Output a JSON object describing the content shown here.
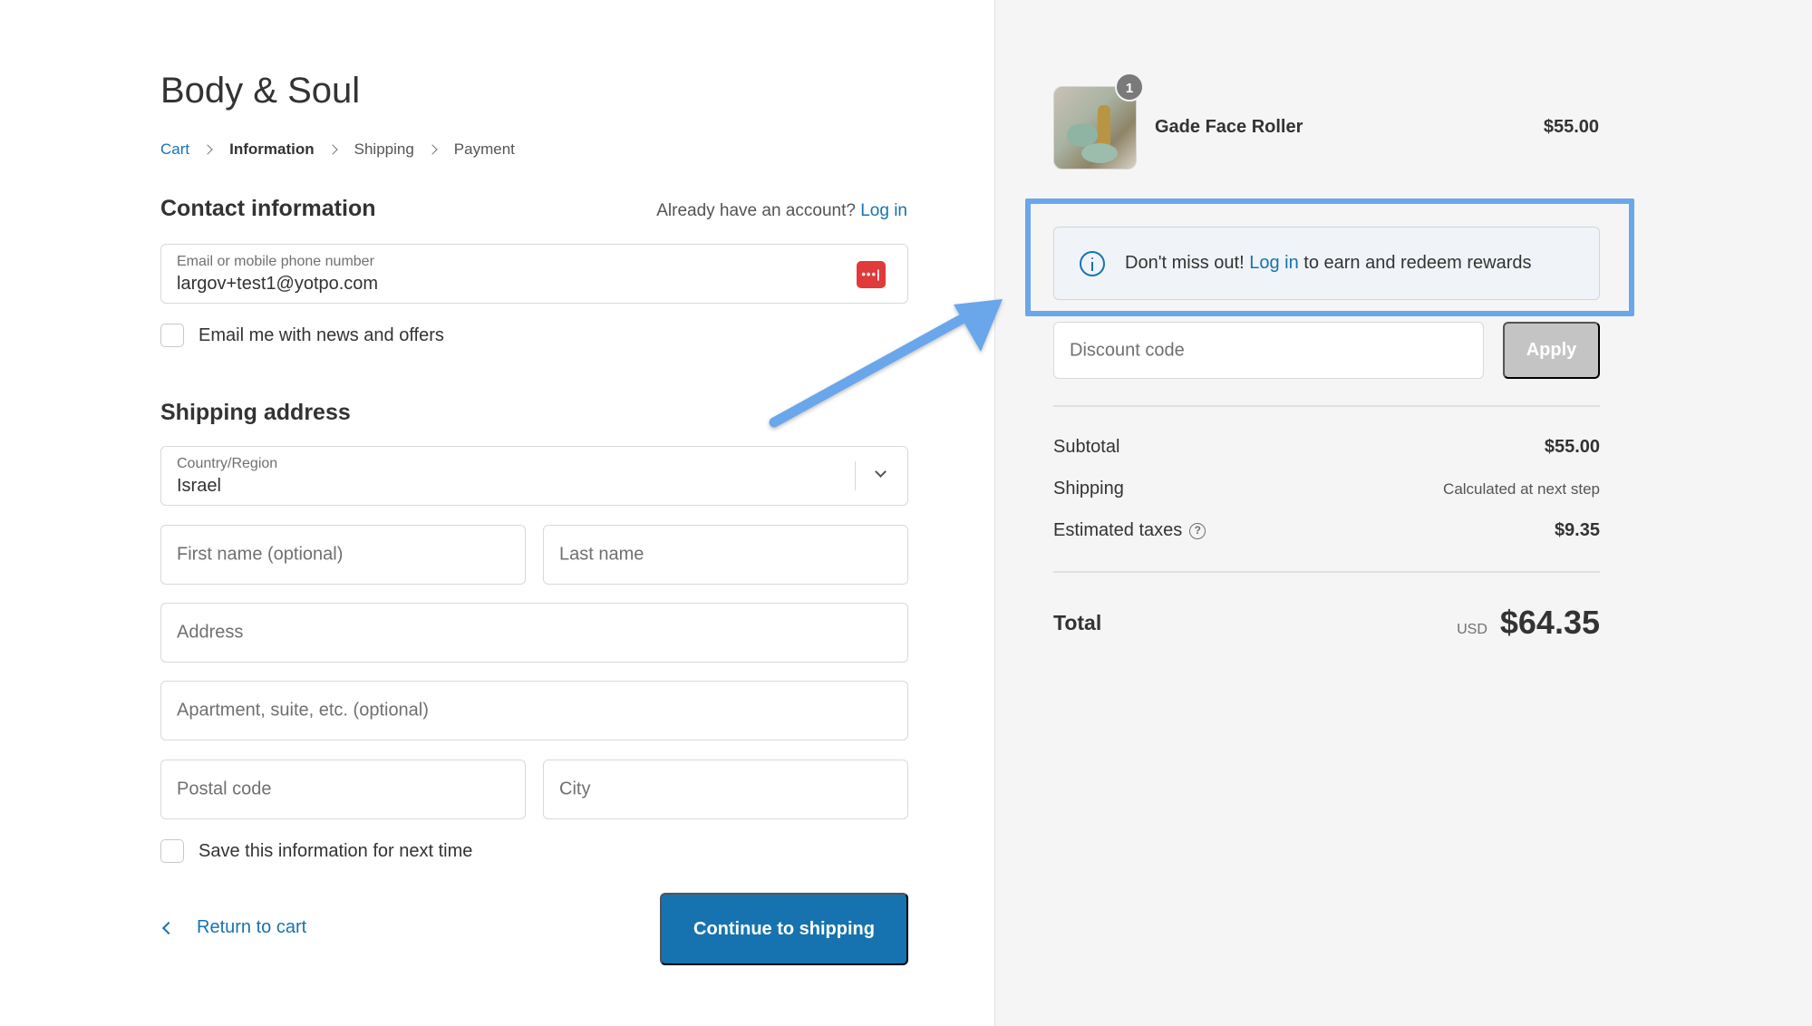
{
  "store": {
    "title": "Body & Soul"
  },
  "breadcrumb": {
    "items": [
      {
        "label": "Cart"
      },
      {
        "label": "Information"
      },
      {
        "label": "Shipping"
      },
      {
        "label": "Payment"
      }
    ]
  },
  "contact": {
    "title": "Contact information",
    "account_prompt": "Already have an account?",
    "login_label": "Log in",
    "email_label": "Email or mobile phone number",
    "email_value": "largov+test1@yotpo.com",
    "password_manager_icon": "•••|",
    "newsletter_label": "Email me with news and offers"
  },
  "shipping": {
    "title": "Shipping address",
    "country_label": "Country/Region",
    "country_value": "Israel",
    "first_name_placeholder": "First name (optional)",
    "last_name_placeholder": "Last name",
    "address_placeholder": "Address",
    "apartment_placeholder": "Apartment, suite, etc. (optional)",
    "postal_placeholder": "Postal code",
    "city_placeholder": "City",
    "save_info_label": "Save this information for next time"
  },
  "actions": {
    "return_label": "Return to cart",
    "continue_label": "Continue to shipping"
  },
  "summary": {
    "product": {
      "name": "Gade Face Roller",
      "price": "$55.00",
      "quantity": "1"
    },
    "rewards": {
      "prefix": "Don't miss out!",
      "link": "Log in",
      "suffix": "to earn and redeem rewards"
    },
    "discount_placeholder": "Discount code",
    "apply_label": "Apply",
    "subtotal_label": "Subtotal",
    "subtotal_value": "$55.00",
    "shipping_label": "Shipping",
    "shipping_value": "Calculated at next step",
    "taxes_label": "Estimated taxes",
    "taxes_help": "?",
    "taxes_value": "$9.35",
    "total_label": "Total",
    "currency": "USD",
    "total_value": "$64.35"
  },
  "colors": {
    "link": "#1773b0",
    "primary_button": "#1773b0",
    "highlight_annotation": "#6ba6ea",
    "apply_disabled": "#c4c4c4",
    "sidebar_background": "#f5f5f5"
  },
  "icons": [
    "chevron-right-icon",
    "password-manager-icon",
    "chevron-down-icon",
    "chevron-left-icon",
    "info-icon",
    "question-icon",
    "annotation-arrow"
  ]
}
